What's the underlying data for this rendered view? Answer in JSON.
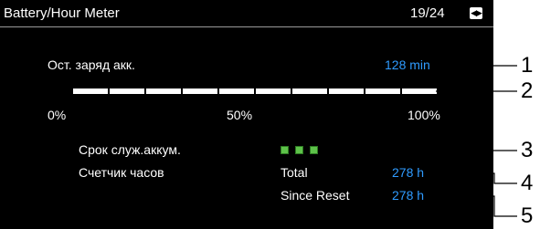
{
  "header": {
    "title": "Battery/Hour Meter",
    "page": "19/24",
    "page_switch_icon": "page-arrows-icon"
  },
  "remaining_charge": {
    "label": "Ост. заряд акк.",
    "value": "128 min"
  },
  "charge_bar": {
    "fill_fraction": 1.0,
    "scale_labels": [
      "0%",
      "50%",
      "100%"
    ]
  },
  "battery_life": {
    "label": "Срок служ.аккум.",
    "indicator_segments": 3,
    "indicator_color": "#5ec24a"
  },
  "hour_meter": {
    "label": "Счетчик часов",
    "total_label": "Total",
    "total_value": "278 h",
    "since_reset_label": "Since Reset",
    "since_reset_value": "278 h"
  },
  "callouts": [
    "1",
    "2",
    "3",
    "4",
    "5"
  ],
  "colors": {
    "value_blue": "#2f9bff",
    "background": "#000000",
    "text": "#ffffff"
  }
}
